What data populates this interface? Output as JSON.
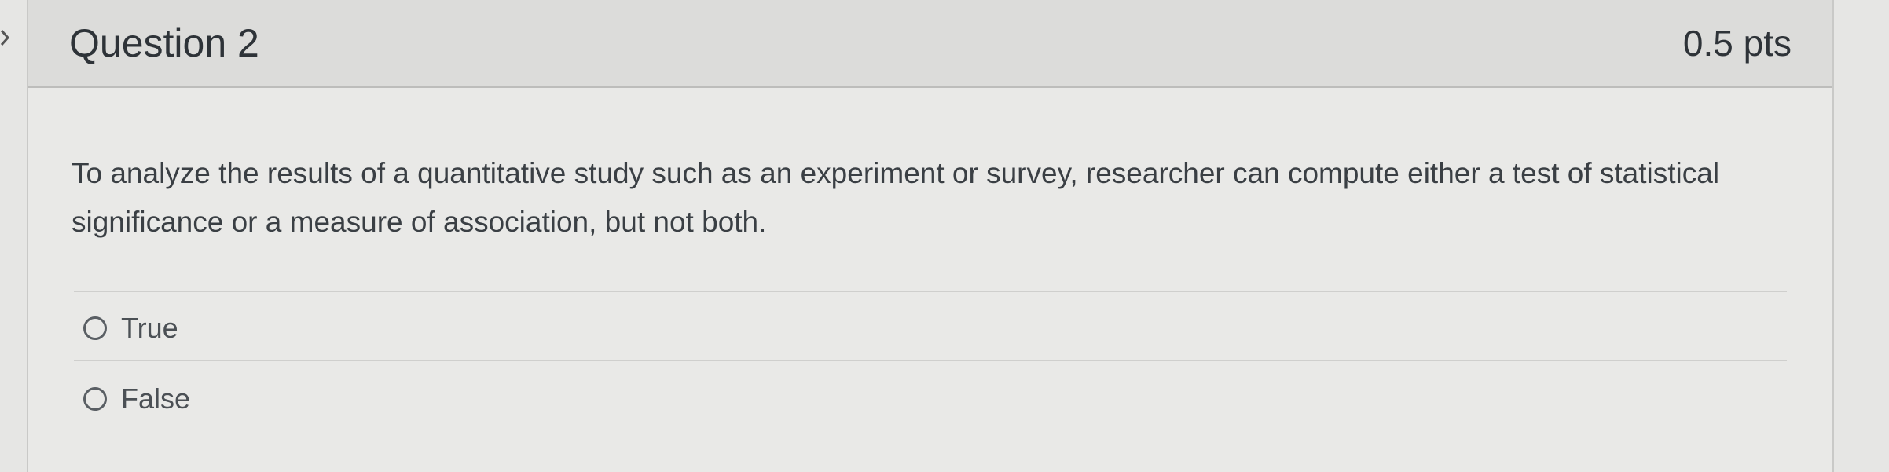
{
  "question": {
    "title": "Question 2",
    "points": "0.5 pts",
    "text": "To analyze the results of a quantitative study such as an experiment or survey, researcher can compute either a test of statistical significance or a measure of association, but not both.",
    "answers": [
      {
        "label": "True",
        "selected": false
      },
      {
        "label": "False",
        "selected": false
      }
    ]
  },
  "icons": {
    "left_nav": "chevron-right-icon"
  },
  "colors": {
    "header_bg": "#dcdcda",
    "body_bg": "#e9e9e7",
    "text": "#2e3338"
  }
}
